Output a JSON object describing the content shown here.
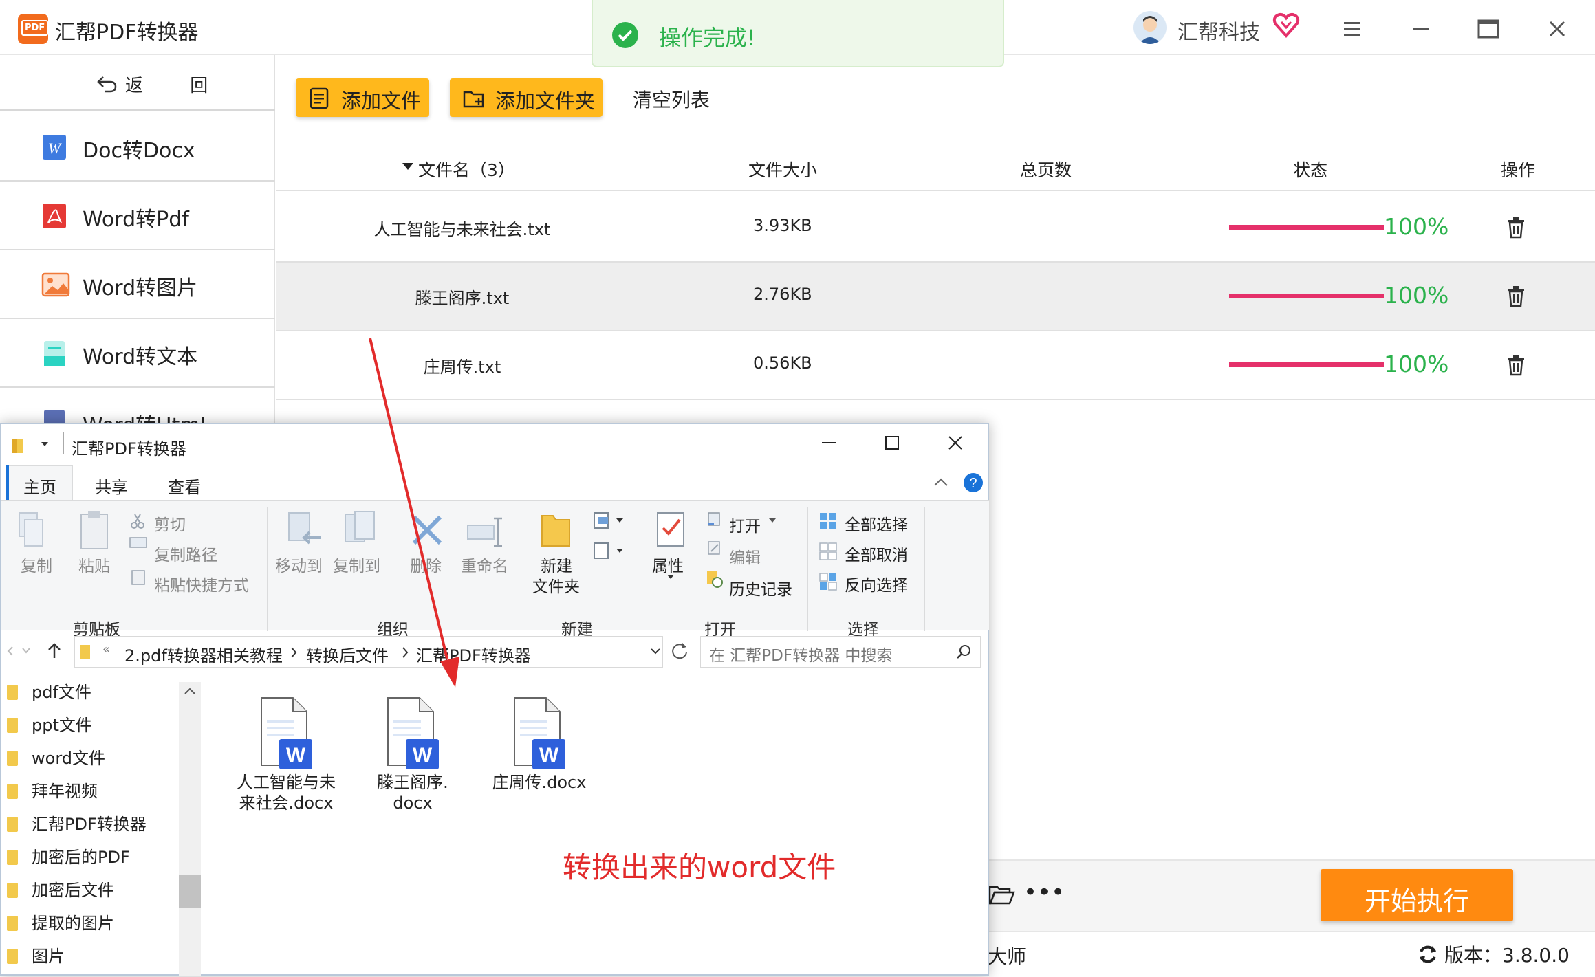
{
  "app": {
    "title": "汇帮PDF转换器",
    "logo_text": "PDF",
    "toast": "操作完成!",
    "company": "汇帮科技",
    "back_label": "返 回",
    "sidebar": [
      {
        "label": "Doc转Docx",
        "icon": "word-icon"
      },
      {
        "label": "Word转Pdf",
        "icon": "pdf-icon"
      },
      {
        "label": "Word转图片",
        "icon": "image-icon"
      },
      {
        "label": "Word转文本",
        "icon": "text-icon"
      },
      {
        "label": "Word转Html",
        "icon": "html-icon"
      }
    ],
    "toolbar": {
      "add_file": "添加文件",
      "add_folder": "添加文件夹",
      "clear": "清空列表"
    },
    "table": {
      "headers": {
        "name": "文件名（3）",
        "size": "文件大小",
        "pages": "总页数",
        "status": "状态",
        "actions": "操作"
      },
      "rows": [
        {
          "name": "人工智能与未来社会.txt",
          "size": "3.93KB",
          "pages": "",
          "progress": "100%"
        },
        {
          "name": "滕王阁序.txt",
          "size": "2.76KB",
          "pages": "",
          "progress": "100%"
        },
        {
          "name": "庄周传.txt",
          "size": "0.56KB",
          "pages": "",
          "progress": "100%"
        }
      ]
    },
    "start_button": "开始执行",
    "more": "•••",
    "brand_tail": "大师",
    "version": "版本：3.8.0.0",
    "colors": {
      "accent": "#ffb81c",
      "start": "#ff8a10",
      "progress": "#e5306a",
      "success": "#2bb24c"
    }
  },
  "explorer": {
    "title": "汇帮PDF转换器",
    "tabs": [
      "主页",
      "共享",
      "查看"
    ],
    "ribbon": {
      "copy": "复制",
      "paste": "粘贴",
      "cut": "剪切",
      "copy_path": "复制路径",
      "paste_shortcut": "粘贴快捷方式",
      "clipboard_group": "剪贴板",
      "move_to": "移动到",
      "copy_to": "复制到",
      "delete": "删除",
      "rename": "重命名",
      "organize_group": "组织",
      "new_folder_line1": "新建",
      "new_folder_line2": "文件夹",
      "new_group": "新建",
      "properties": "属性",
      "open": "打开",
      "edit": "编辑",
      "history": "历史记录",
      "open_group": "打开",
      "select_all": "全部选择",
      "select_none": "全部取消",
      "invert_selection": "反向选择",
      "select_group": "选择"
    },
    "breadcrumb": [
      "2.pdf转换器相关教程",
      "转换后文件",
      "汇帮PDF转换器"
    ],
    "search_placeholder": "在 汇帮PDF转换器 中搜索",
    "nav": [
      "pdf文件",
      "ppt文件",
      "word文件",
      "拜年视频",
      "汇帮PDF转换器",
      "加密后的PDF",
      "加密后文件",
      "提取的图片",
      "图片"
    ],
    "files": [
      {
        "line1": "人工智能与未",
        "line2": "来社会.docx"
      },
      {
        "line1": "滕王阁序.",
        "line2": "docx"
      },
      {
        "line1": "庄周传.docx",
        "line2": ""
      }
    ]
  },
  "annotation": "转换出来的word文件"
}
